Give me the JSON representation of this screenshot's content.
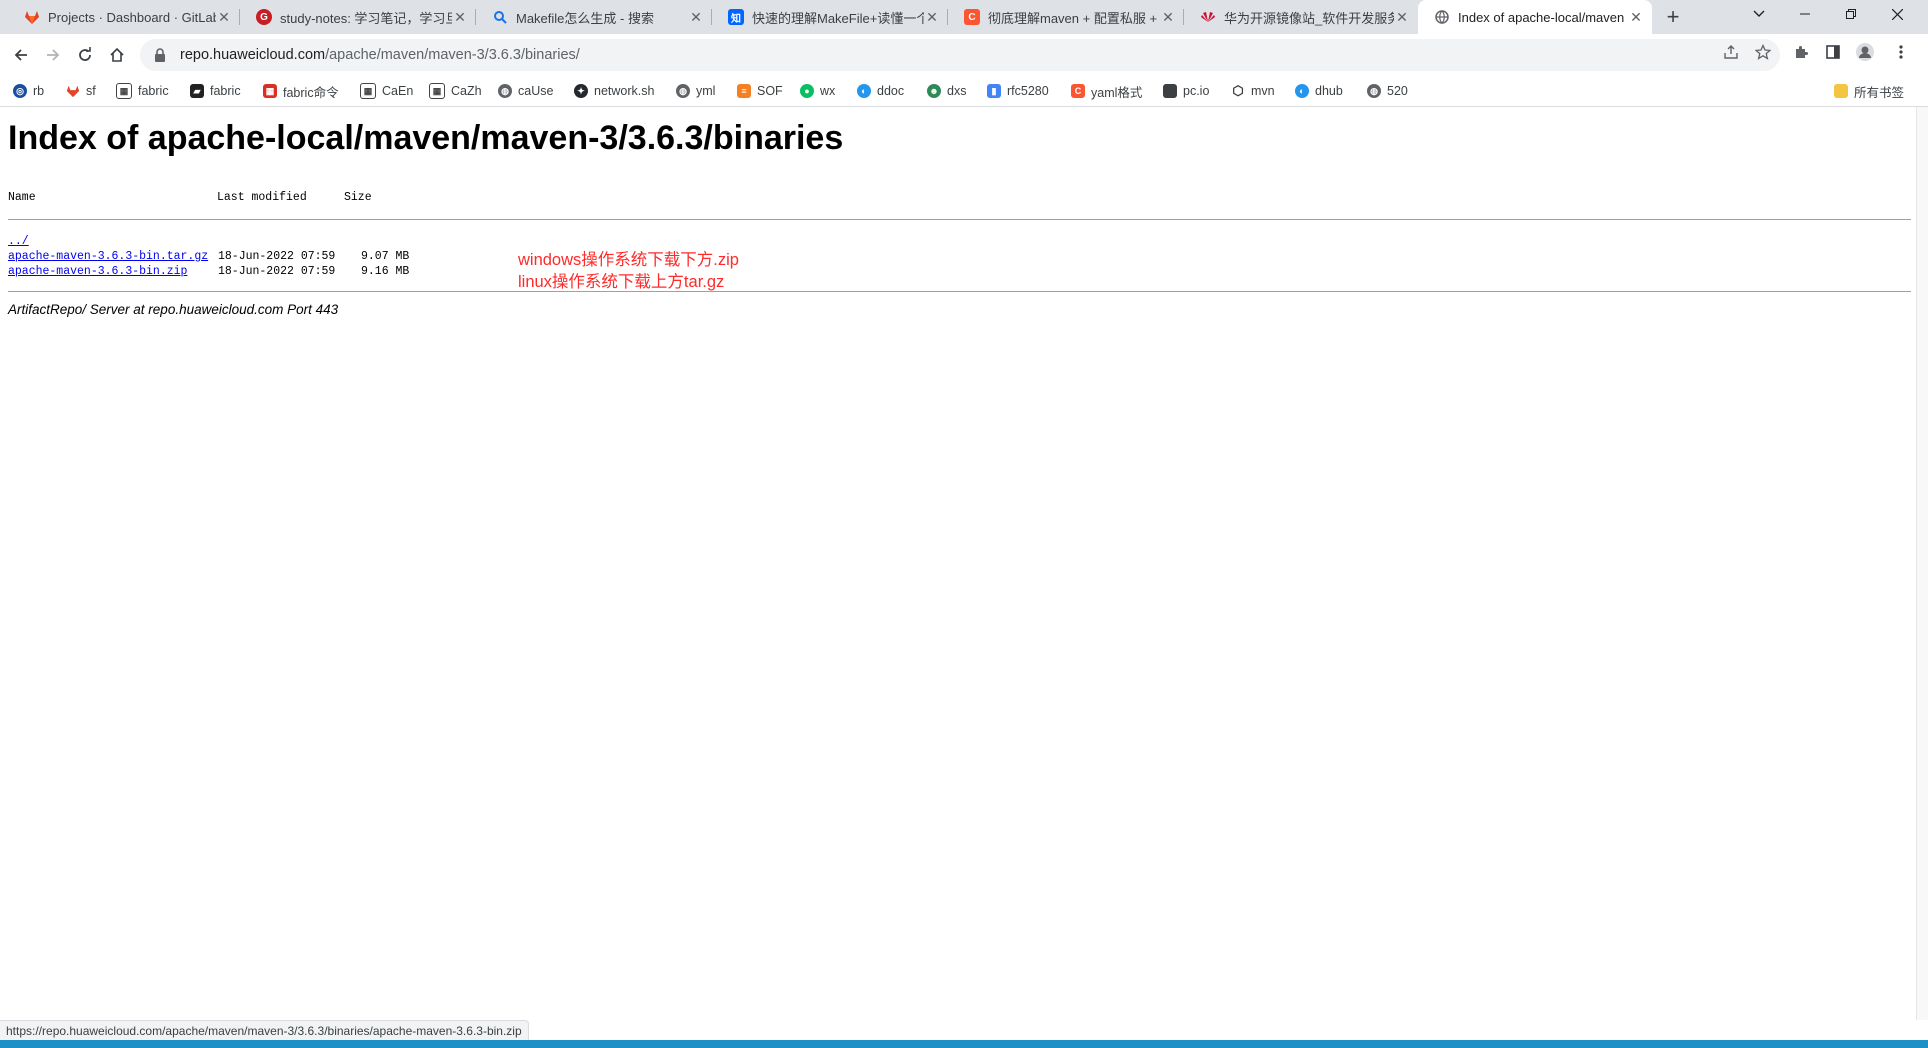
{
  "tabs": [
    {
      "label": "Projects · Dashboard · GitLab",
      "icon": "gitlab-icon",
      "color": "#e24329"
    },
    {
      "label": "study-notes: 学习笔记，学习旦",
      "icon": "gitee-icon",
      "color": "#c71d23"
    },
    {
      "label": "Makefile怎么生成 - 搜索",
      "icon": "search-icon",
      "color": "#1a73e8"
    },
    {
      "label": "快速的理解MakeFile+读懂一个",
      "icon": "zhihu-icon",
      "color": "#0066ff"
    },
    {
      "label": "彻底理解maven + 配置私服 +",
      "icon": "csdn-icon",
      "color": "#fc5531"
    },
    {
      "label": "华为开源镜像站_软件开发服务_",
      "icon": "huawei-icon",
      "color": "#cf0a2c"
    },
    {
      "label": "Index of apache-local/maven",
      "icon": "globe-icon",
      "color": "#5f6368"
    }
  ],
  "address": {
    "host": "repo.huaweicloud.com",
    "path": "/apache/maven/maven-3/3.6.3/binaries/"
  },
  "bookmarks": [
    {
      "label": "rb",
      "icon": "rb-icon",
      "color": "#1a4fa0"
    },
    {
      "label": "sf",
      "icon": "gitlab-icon",
      "color": "#e24329"
    },
    {
      "label": "fabric",
      "icon": "book-icon",
      "color": "#444444"
    },
    {
      "label": "fabric",
      "icon": "doc-icon",
      "color": "#222222"
    },
    {
      "label": "fabric命令",
      "icon": "grid-icon",
      "color": "#d93025"
    },
    {
      "label": "CaEn",
      "icon": "book-icon",
      "color": "#444444"
    },
    {
      "label": "CaZh",
      "icon": "book-icon",
      "color": "#444444"
    },
    {
      "label": "caUse",
      "icon": "globe-icon",
      "color": "#5f6368"
    },
    {
      "label": "network.sh",
      "icon": "github-icon",
      "color": "#24292e"
    },
    {
      "label": "yml",
      "icon": "globe-icon",
      "color": "#5f6368"
    },
    {
      "label": "SOF",
      "icon": "stackoverflow-icon",
      "color": "#f48024"
    },
    {
      "label": "wx",
      "icon": "wechat-icon",
      "color": "#07c160"
    },
    {
      "label": "ddoc",
      "icon": "docker-icon",
      "color": "#2496ed"
    },
    {
      "label": "dxs",
      "icon": "frog-icon",
      "color": "#2e8b57"
    },
    {
      "label": "rfc5280",
      "icon": "file-icon",
      "color": "#4285f4"
    },
    {
      "label": "yaml格式",
      "icon": "csdn-icon",
      "color": "#fc5531"
    },
    {
      "label": "pc.io",
      "icon": "square-icon",
      "color": "#3c4043"
    },
    {
      "label": "mvn",
      "icon": "hexagon-icon",
      "color": "#3c4043"
    },
    {
      "label": "dhub",
      "icon": "docker-icon",
      "color": "#2496ed"
    },
    {
      "label": "520",
      "icon": "globe-icon",
      "color": "#5f6368"
    }
  ],
  "bookmarks_folder": "所有书签",
  "page": {
    "title": "Index of apache-local/maven/maven-3/3.6.3/binaries",
    "columns": {
      "name": "Name",
      "modified": "Last modified",
      "size": "Size"
    },
    "parent_link": "../",
    "files": [
      {
        "name": "apache-maven-3.6.3-bin.tar.gz",
        "modified": "18-Jun-2022 07:59",
        "size": "9.07 MB"
      },
      {
        "name": "apache-maven-3.6.3-bin.zip",
        "modified": "18-Jun-2022 07:59",
        "size": "9.16 MB"
      }
    ],
    "annotations": [
      "windows操作系统下载下方.zip",
      "linux操作系统下载上方tar.gz"
    ],
    "server_info": "ArtifactRepo/ Server at repo.huaweicloud.com Port 443"
  },
  "status_url": "https://repo.huaweicloud.com/apache/maven/maven-3/3.6.3/binaries/apache-maven-3.6.3-bin.zip"
}
